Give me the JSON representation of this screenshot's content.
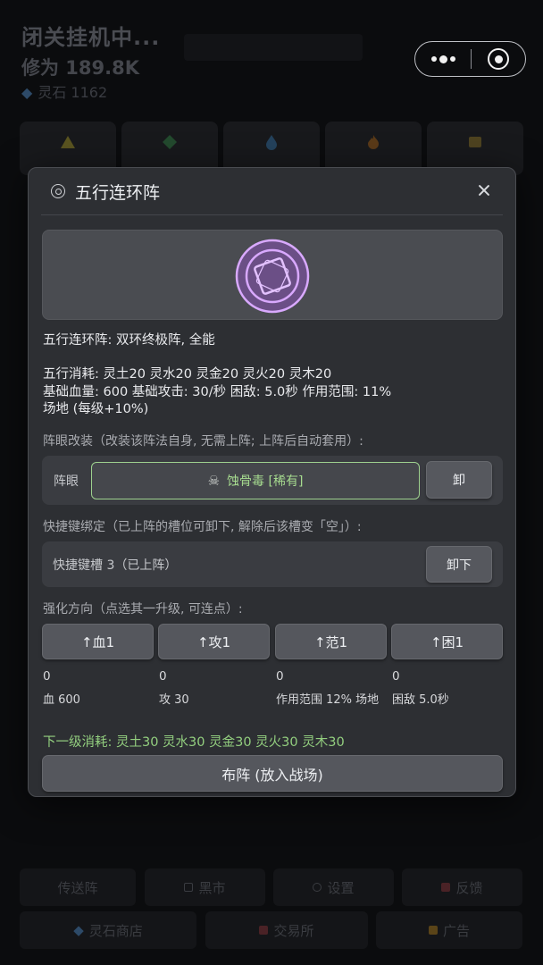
{
  "background": {
    "title": "闭关挂机中...",
    "cultivation": "修为 189.8K",
    "spirit_stone": "灵石 1162",
    "bottom_row1": [
      "传送阵",
      "黑市",
      "设置",
      "反馈"
    ],
    "bottom_row2": [
      "灵石商店",
      "交易所",
      "广告"
    ]
  },
  "modal": {
    "title": "五行连环阵",
    "summary": "五行连环阵: 双环终极阵, 全能",
    "cost_line": "五行消耗: 灵土20 灵水20 灵金20 灵火20 灵木20",
    "stats_line": "基础血量: 600 基础攻击: 30/秒 困敌: 5.0秒 作用范围: 11%",
    "field_line": "场地 (每级+10%)",
    "eye_section_label": "阵眼改装（改装该阵法自身, 无需上阵; 上阵后自动套用）:",
    "eye_label": "阵眼",
    "eye_value": "蚀骨毒 [稀有]",
    "eye_unequip": "卸",
    "hotkey_section_label": "快捷键绑定（已上阵的槽位可卸下, 解除后该槽变「空」）:",
    "hotkey_slot": "快捷键槽 3（已上阵）",
    "hotkey_unequip": "卸下",
    "upgrade_section_label": "强化方向（点选其一升级, 可连点）:",
    "upgrades": [
      {
        "label": "↑血1",
        "level": "0",
        "value": "血 600"
      },
      {
        "label": "↑攻1",
        "level": "0",
        "value": "攻 30"
      },
      {
        "label": "↑范1",
        "level": "0",
        "value": "作用范围 12% 场地"
      },
      {
        "label": "↑困1",
        "level": "0",
        "value": "困敌 5.0秒"
      }
    ],
    "next_cost": "下一级消耗: 灵土30 灵水30 灵金30 灵火30 灵木30",
    "deploy_label": "布阵 (放入战场)"
  },
  "colors": {
    "modal_bg": "#2d2f33",
    "accent_green": "#93cf7f",
    "rune_purple": "#c79af5"
  },
  "icons": {
    "title": "target-icon",
    "close": "close-icon",
    "eye": "skull-icon",
    "hero": "rune-circle-icon"
  }
}
